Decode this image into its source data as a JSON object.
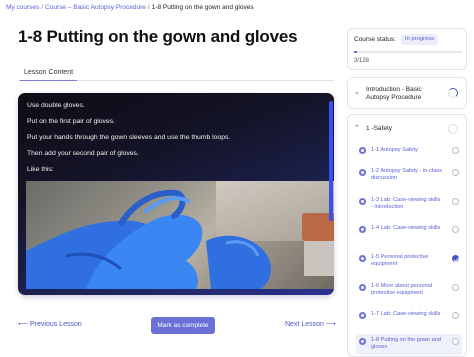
{
  "breadcrumb": {
    "my_courses": "My courses",
    "course": "Course – Basic Autopsy Procedure",
    "current": "1-8 Putting on the gown and gloves",
    "separator": "/"
  },
  "page_title": "1-8 Putting on the gown and gloves",
  "tabs": [
    {
      "label": "Lesson Content"
    }
  ],
  "lesson": {
    "lines": [
      "Use double gloves.",
      "Put on the first pair of gloves.",
      "Put your hands through the gown sleeves and use the thumb loops.",
      "Then add your second pair of gloves.",
      "Like this:"
    ]
  },
  "footer": {
    "prev_label": "Previous Lesson",
    "mark_label": "Mark as complete",
    "next_label": "Next Lesson",
    "prev_arrow": "⟵",
    "next_arrow": "⟶"
  },
  "course_status": {
    "label": "Course status:",
    "badge": "In progress",
    "count": "3/128",
    "progress_fraction": 0.0234
  },
  "sections": [
    {
      "title": "Introduction - Basic Autopsy Procedure",
      "expanded": false
    },
    {
      "title": "1 -Safety",
      "expanded": true
    }
  ],
  "lessons": [
    {
      "label": "1-1 Autopsy Safety",
      "done": false
    },
    {
      "label": "1-2 Autopsy Safety - in-class discussion",
      "done": false
    },
    {
      "label": "1-3 Lab: Case-viewing skills - introduction",
      "done": false
    },
    {
      "label": "1-4 Lab: Case-viewing skills",
      "done": false
    },
    {
      "label": "1-5 Personal protective equipment",
      "done": true
    },
    {
      "label": "1-6 More about personal protective equipment",
      "done": false
    },
    {
      "label": "1-7 Lab: Case-viewing skills",
      "done": false
    },
    {
      "label": "1-8 Putting on the gown and gloves",
      "done": false,
      "active": true
    }
  ],
  "colors": {
    "accent": "#4b52c4",
    "button": "#6a70d6",
    "badge_bg": "#ececfb"
  },
  "icons": {
    "chevron_down": "chevron-down-icon",
    "chevron_up": "chevron-up-icon",
    "lesson_dot": "lesson-dot-icon",
    "check": "check-icon"
  }
}
